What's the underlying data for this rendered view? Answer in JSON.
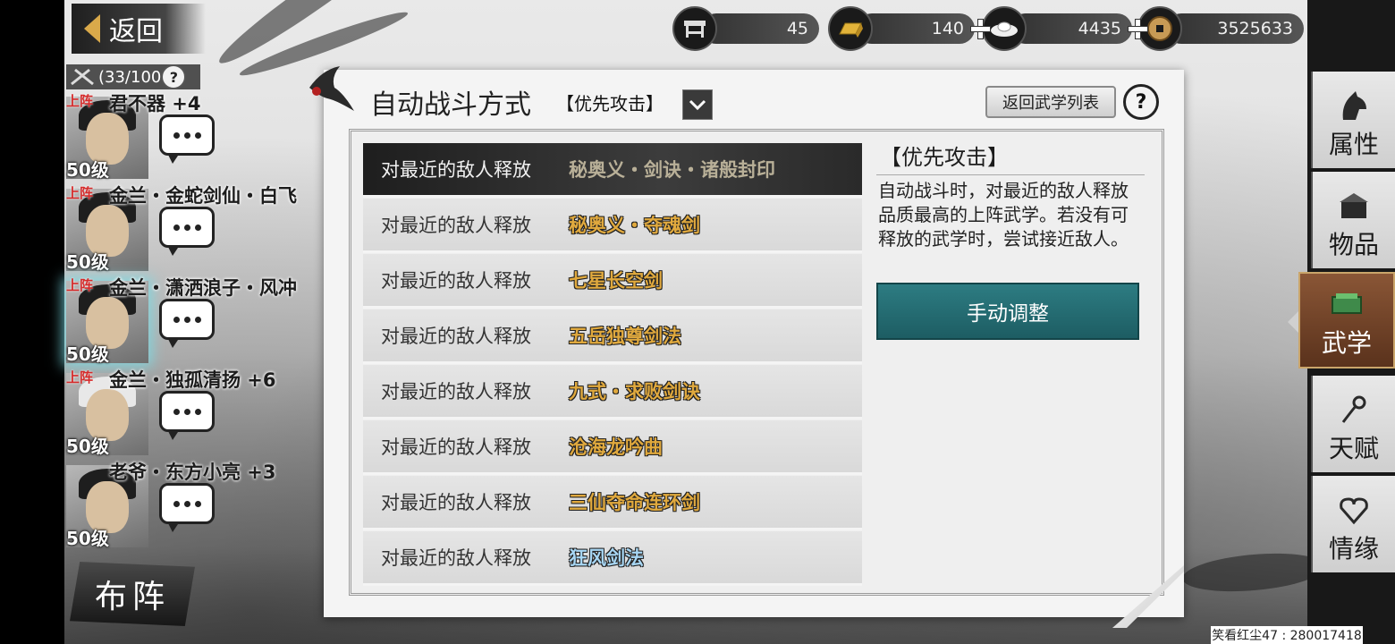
{
  "nav": {
    "back_label": "返回"
  },
  "currency": [
    {
      "icon": "stool-icon",
      "value": "45"
    },
    {
      "icon": "gold-bar-icon",
      "value": "140"
    },
    {
      "icon": "silver-ingot-icon",
      "value": "4435"
    },
    {
      "icon": "copper-coin-icon",
      "value": "3525633"
    }
  ],
  "roster": {
    "count": "(33/100",
    "members": [
      {
        "tag": "上阵",
        "name": "君不器  +4",
        "level": "50级"
      },
      {
        "tag": "上阵",
        "name": "金兰・金蛇剑仙・白飞",
        "level": "50级"
      },
      {
        "tag": "上阵",
        "name": "金兰・潇洒浪子・风冲",
        "level": "50级"
      },
      {
        "tag": "上阵",
        "name": "金兰・独孤清扬  +6",
        "level": "50级"
      },
      {
        "tag": "",
        "name": "老爷・东方小亮  +3",
        "level": "50级"
      }
    ],
    "formation_label": "布阵"
  },
  "panel": {
    "title": "自动战斗方式",
    "mode_label": "【优先攻击】",
    "return_label": "返回武学列表",
    "help_label": "?",
    "rows": [
      {
        "cond": "对最近的敌人释放",
        "skill": "秘奥义・剑诀・诸般封印"
      },
      {
        "cond": "对最近的敌人释放",
        "skill": "秘奥义・夺魂剑"
      },
      {
        "cond": "对最近的敌人释放",
        "skill": "七星长空剑"
      },
      {
        "cond": "对最近的敌人释放",
        "skill": "五岳独尊剑法"
      },
      {
        "cond": "对最近的敌人释放",
        "skill": "九式・求败剑诀"
      },
      {
        "cond": "对最近的敌人释放",
        "skill": "沧海龙吟曲"
      },
      {
        "cond": "对最近的敌人释放",
        "skill": "三仙夺命连环剑"
      },
      {
        "cond": "对最近的敌人释放",
        "skill": "狂风剑法"
      }
    ],
    "desc_title": "【优先攻击】",
    "desc_text": "自动战斗时，对最近的敌人释放品质最高的上阵武学。若没有可释放的武学时，尝试接近敌人。",
    "manual_label": "手动调整"
  },
  "side_nav": [
    {
      "label": "属性",
      "icon": "horse-head-icon"
    },
    {
      "label": "物品",
      "icon": "treasure-box-icon"
    },
    {
      "label": "武学",
      "icon": "scroll-book-icon",
      "active": true
    },
    {
      "label": "天赋",
      "icon": "talent-knot-icon"
    },
    {
      "label": "情缘",
      "icon": "heart-knot-icon"
    }
  ],
  "footer": {
    "user_id": "笑看红尘47 : 280017418"
  },
  "colors": {
    "skill_gold": "#e0a93e",
    "skill_blue": "#a7d6f3",
    "manual_teal": "#2d7c82",
    "active_tab": "#8a5636"
  }
}
